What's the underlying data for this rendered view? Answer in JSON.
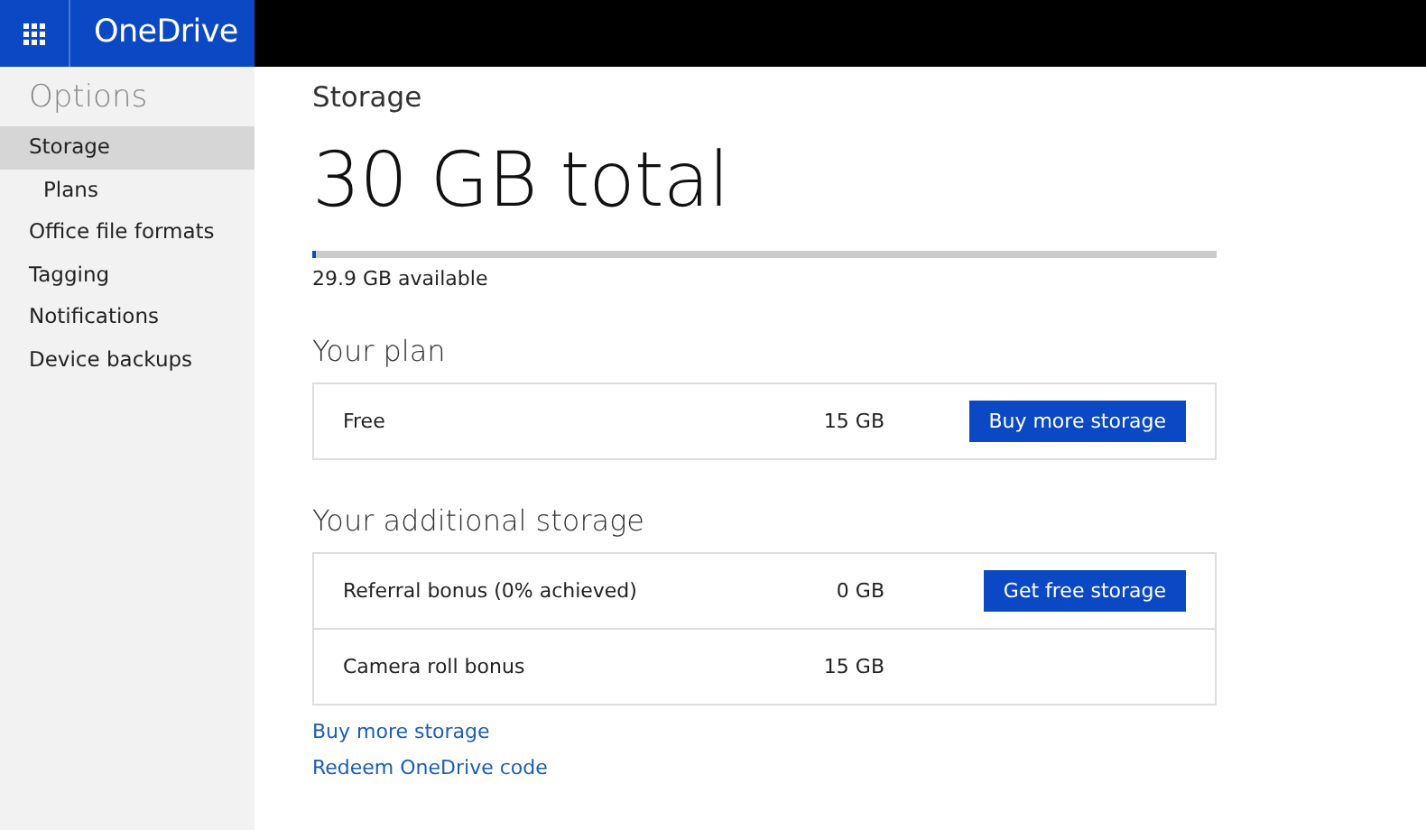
{
  "app_bar": {
    "title": "OneDrive"
  },
  "sidebar": {
    "title": "Options",
    "items": [
      {
        "label": "Storage",
        "selected": true,
        "children": [
          {
            "label": "Plans",
            "selected": false
          }
        ]
      },
      {
        "label": "Office file formats",
        "selected": false
      },
      {
        "label": "Tagging",
        "selected": false
      },
      {
        "label": "Notifications",
        "selected": false
      },
      {
        "label": "Device backups",
        "selected": false
      }
    ]
  },
  "main": {
    "heading": "Storage",
    "total": "30 GB total",
    "usage": {
      "level": 0.004,
      "reading": "29.9 GB available"
    },
    "sections": [
      {
        "title": "Your plan",
        "rows": [
          {
            "name": "Free",
            "size": "15 GB",
            "button": "Buy more storage"
          }
        ]
      },
      {
        "title": "Your additional storage",
        "rows": [
          {
            "name": "Referral bonus (0% achieved)",
            "size": "0 GB",
            "button": "Get free storage"
          },
          {
            "name": "Camera roll bonus",
            "size": "15 GB"
          }
        ]
      }
    ],
    "links": [
      "Buy more storage",
      "Redeem OneDrive code"
    ]
  }
}
